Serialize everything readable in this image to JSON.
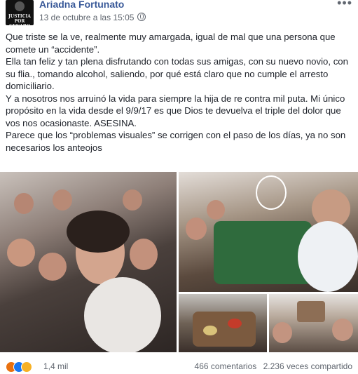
{
  "post": {
    "author": "Ariadna Fortunato",
    "date": "13 de octubre a las 15:05",
    "more_icon": "more-horizontal-icon",
    "avatar_text": "JUSTICIA POR GENARO",
    "paragraphs": [
      "Que triste se la ve, realmente muy amargada, igual de mal que una persona que comete un “accidente”.",
      "Ella tan feliz y tan plena disfrutando con todas sus amigas, con su nuevo novio, con su flia., tomando alcohol, saliendo, por qué está claro que no cumple el arresto domiciliario.",
      "Y a nosotros nos arruinó la vida para siempre la hija de re contra mil puta. Mi único propósito en la vida desde el 9/9/17 es que Dios te devuelva el triple del dolor que vos nos ocasionaste. ASESINA.",
      "Parece que los “problemas visuales” se corrigen con el paso de los días, ya no son necesarios los anteojos"
    ]
  },
  "reactions": {
    "icons": [
      "angry-icon",
      "like-icon",
      "sad-icon"
    ],
    "colors": [
      "#e9710f",
      "#1877f2",
      "#f7b125"
    ],
    "count": "1,4 mil"
  },
  "stats": {
    "comments": "466 comentarios",
    "shares": "2.236 veces compartido"
  }
}
